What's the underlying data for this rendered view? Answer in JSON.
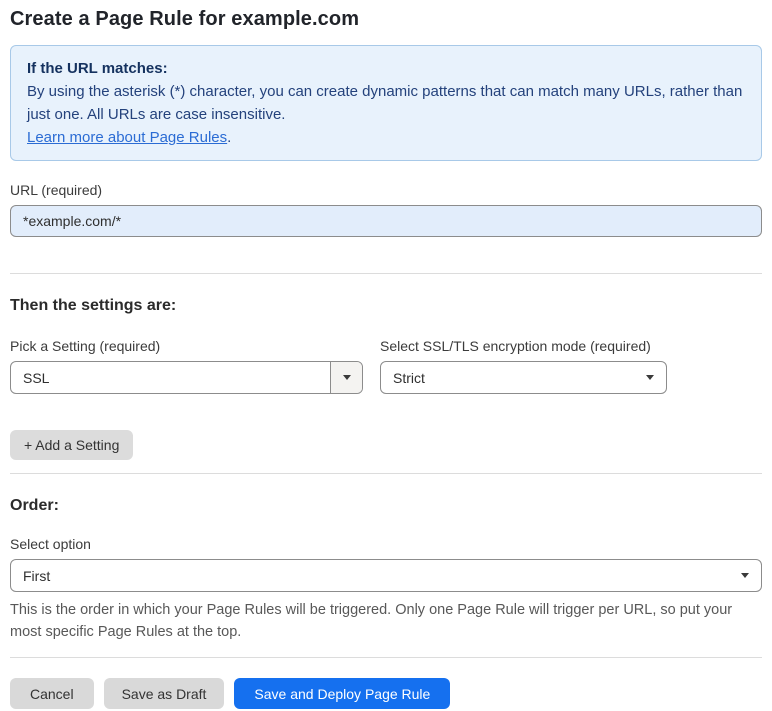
{
  "page": {
    "title": "Create a Page Rule for example.com"
  },
  "info_box": {
    "heading": "If the URL matches:",
    "body": "By using the asterisk (*) character, you can create dynamic patterns that can match many URLs, rather than just one. All URLs are case insensitive.",
    "link_label": "Learn more about Page Rules",
    "link_suffix": "."
  },
  "url_field": {
    "label": "URL (required)",
    "value": "*example.com/*"
  },
  "settings_section": {
    "heading": "Then the settings are:",
    "setting_select": {
      "label": "Pick a Setting (required)",
      "value": "SSL"
    },
    "mode_select": {
      "label": "Select SSL/TLS encryption mode (required)",
      "value": "Strict"
    },
    "add_setting_label": "+ Add a Setting"
  },
  "order_section": {
    "heading": "Order:",
    "select_label": "Select option",
    "value": "First",
    "help_text": "This is the order in which your Page Rules will be triggered. Only one Page Rule will trigger per URL, so put your most specific Page Rules at the top."
  },
  "footer": {
    "cancel_label": "Cancel",
    "save_draft_label": "Save as Draft",
    "save_deploy_label": "Save and Deploy Page Rule"
  },
  "colors": {
    "accent_blue": "#1570ef",
    "info_box_bg": "#e8f2fc",
    "info_box_border": "#a8c9e8",
    "info_heading_text": "#15325f",
    "info_body_text": "#24427c",
    "link_blue": "#2b6cd4",
    "url_input_bg": "#e2edfb",
    "button_gray": "#d9d9d9"
  },
  "icons": {
    "dropdown_caret": "caret-down"
  }
}
